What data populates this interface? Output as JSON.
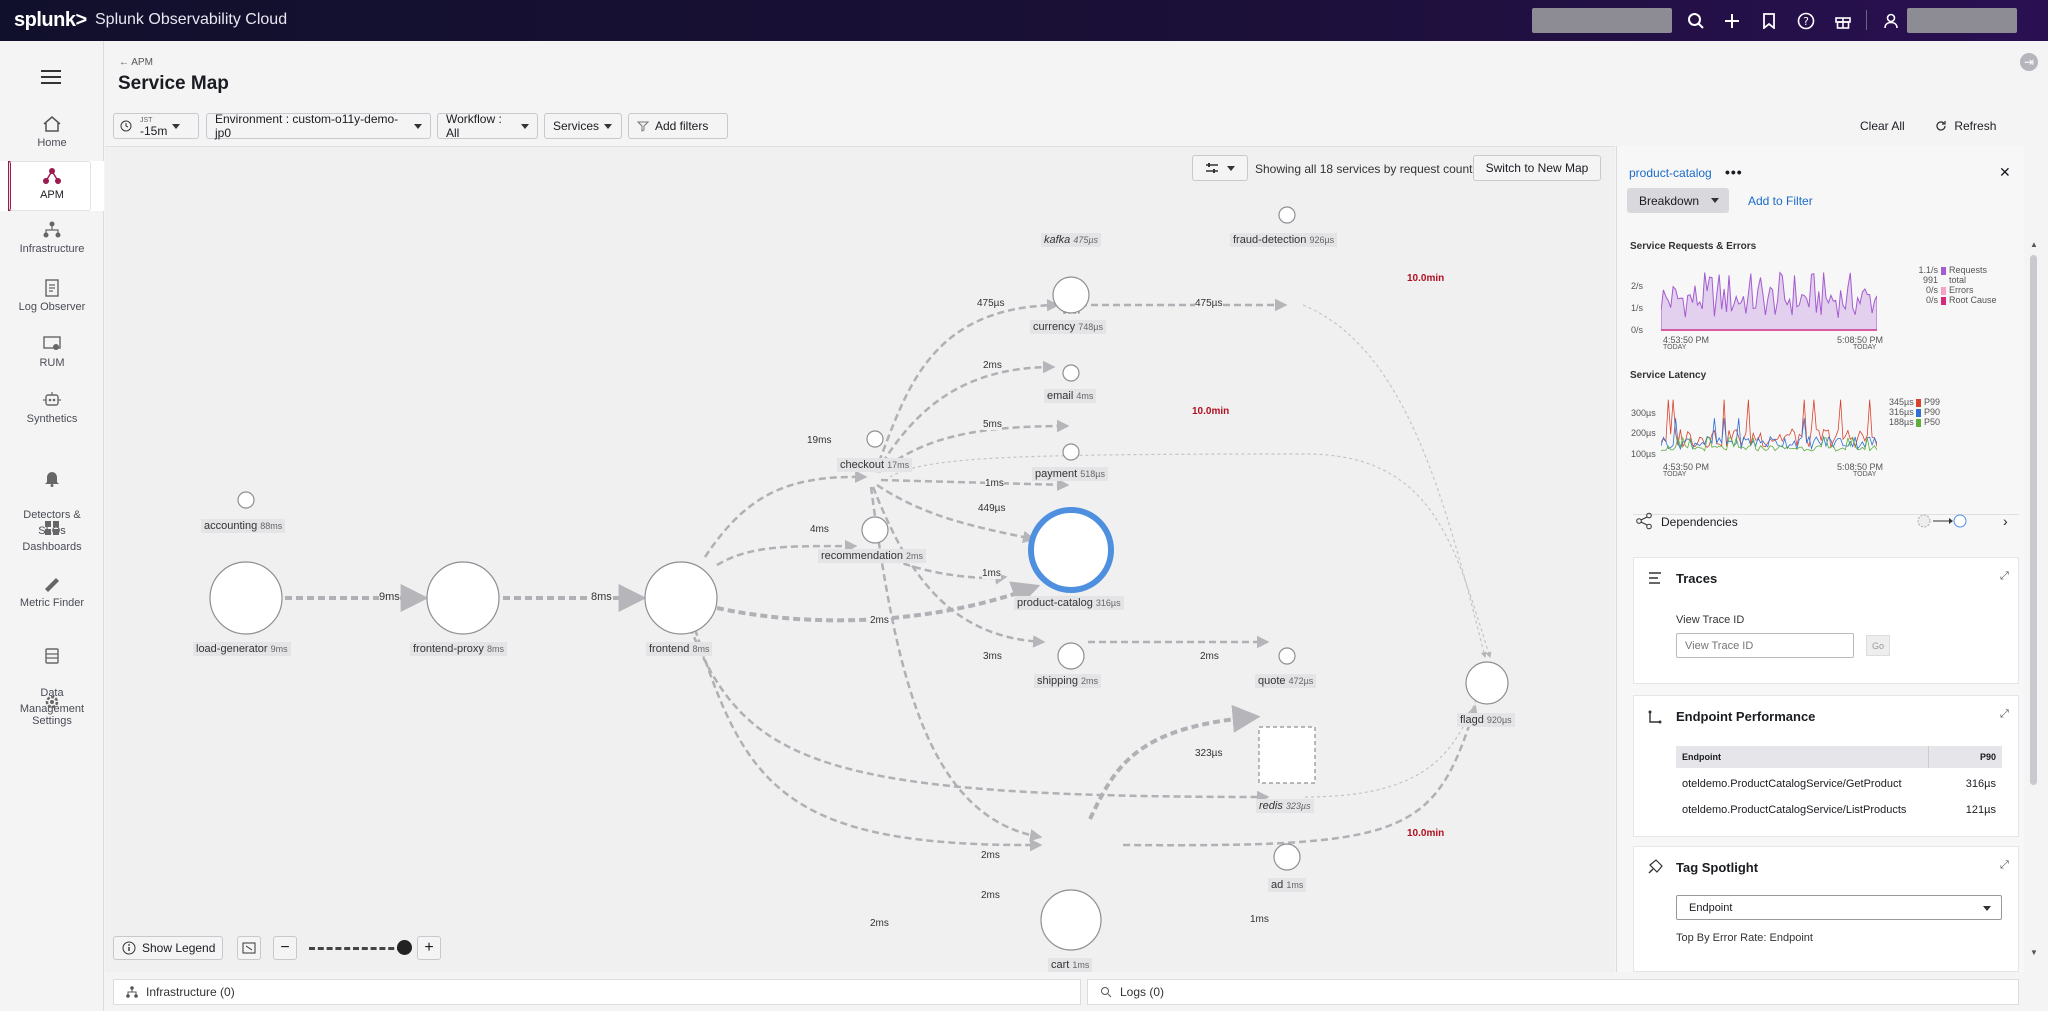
{
  "topbar": {
    "logo": "splunk>",
    "app": "Splunk Observability Cloud"
  },
  "sidebar": {
    "items": [
      {
        "label": "Home"
      },
      {
        "label": "APM"
      },
      {
        "label": "Infrastructure"
      },
      {
        "label": "Log Observer"
      },
      {
        "label": "RUM"
      },
      {
        "label": "Synthetics"
      },
      {
        "label": "Detectors &\nSLOs"
      },
      {
        "label": "Dashboards"
      },
      {
        "label": "Metric Finder"
      },
      {
        "label": "Data\nManagement"
      },
      {
        "label": "Settings"
      }
    ]
  },
  "header": {
    "breadcrumb": "APM",
    "title": "Service Map"
  },
  "filters": {
    "time_tz": "JST",
    "time": "-15m",
    "environment": "Environment : custom-o11y-demo-jp0",
    "workflow": "Workflow : All",
    "services": "Services",
    "add_filters": "Add filters",
    "clear_all": "Clear All",
    "refresh": "Refresh"
  },
  "map": {
    "showing": "Showing all 18 services by request count",
    "switch": "Switch to New Map",
    "show_legend": "Show Legend",
    "nodes": [
      {
        "name": "accounting",
        "lat": "88ms"
      },
      {
        "name": "load-generator",
        "lat": "9ms"
      },
      {
        "name": "frontend-proxy",
        "lat": "8ms"
      },
      {
        "name": "frontend",
        "lat": "8ms"
      },
      {
        "name": "checkout",
        "lat": "17ms"
      },
      {
        "name": "recommendation",
        "lat": "2ms"
      },
      {
        "name": "kafka",
        "lat": "475µs"
      },
      {
        "name": "fraud-detection",
        "lat": "926µs"
      },
      {
        "name": "currency",
        "lat": "748µs"
      },
      {
        "name": "email",
        "lat": "4ms"
      },
      {
        "name": "payment",
        "lat": "518µs"
      },
      {
        "name": "product-catalog",
        "lat": "316µs"
      },
      {
        "name": "shipping",
        "lat": "2ms"
      },
      {
        "name": "quote",
        "lat": "472µs"
      },
      {
        "name": "redis",
        "lat": "323µs"
      },
      {
        "name": "flagd",
        "lat": "920µs"
      },
      {
        "name": "ad",
        "lat": "1ms"
      },
      {
        "name": "cart",
        "lat": "1ms"
      }
    ],
    "edges": {
      "lg_fp": "9ms",
      "fp_fe": "8ms",
      "co": "19ms",
      "kafka_in": "475µs",
      "kafka_out": "475µs",
      "currency": "2ms",
      "email": "5ms",
      "payment": "1ms",
      "pc_co": "449µs",
      "rec": "4ms",
      "rec_pc": "1ms",
      "fe_pc": "2ms",
      "ship": "3ms",
      "quote": "2ms",
      "redis": "323µs",
      "ad": "2ms",
      "cart": "2ms",
      "cart_co": "2ms",
      "cart_flagd": "1ms",
      "slow1": "10.0min",
      "slow2": "10.0min",
      "slow3": "10.0min"
    }
  },
  "bottom": {
    "infra": "Infrastructure (0)",
    "logs": "Logs (0)"
  },
  "panel": {
    "service": "product-catalog",
    "breakdown": "Breakdown",
    "add_filter": "Add to Filter",
    "req_title": "Service Requests & Errors",
    "req_y": [
      "2/s",
      "1/s",
      "0/s"
    ],
    "req_x": [
      "4:53:50 PM",
      "5:08:50 PM"
    ],
    "today": "TODAY",
    "req_legend": [
      {
        "v": "1.1/s",
        "l": "Requests",
        "c": "#a55ccf"
      },
      {
        "v": "991",
        "l": "total",
        "c": ""
      },
      {
        "v": "0/s",
        "l": "Errors",
        "c": "#f2a3c6"
      },
      {
        "v": "0/s",
        "l": "Root Cause",
        "c": "#d6287a"
      }
    ],
    "lat_title": "Service Latency",
    "lat_y": [
      "300µs",
      "200µs",
      "100µs"
    ],
    "lat_legend": [
      {
        "v": "345µs",
        "l": "P99",
        "c": "#d8432c"
      },
      {
        "v": "316µs",
        "l": "P90",
        "c": "#2f6fd6"
      },
      {
        "v": "188µs",
        "l": "P50",
        "c": "#5fae3b"
      }
    ],
    "dependencies": "Dependencies",
    "traces": "Traces",
    "view_trace_label": "View Trace ID",
    "view_trace_ph": "View Trace ID",
    "go": "Go",
    "endpoint_perf": "Endpoint Performance",
    "ep_col1": "Endpoint",
    "ep_col2": "P90",
    "endpoints": [
      {
        "name": "oteldemo.ProductCatalogService/GetProduct",
        "p90": "316µs"
      },
      {
        "name": "oteldemo.ProductCatalogService/ListProducts",
        "p90": "121µs"
      }
    ],
    "tag_spotlight": "Tag Spotlight",
    "tag_select": "Endpoint",
    "tag_sub": "Top By Error Rate: Endpoint"
  }
}
